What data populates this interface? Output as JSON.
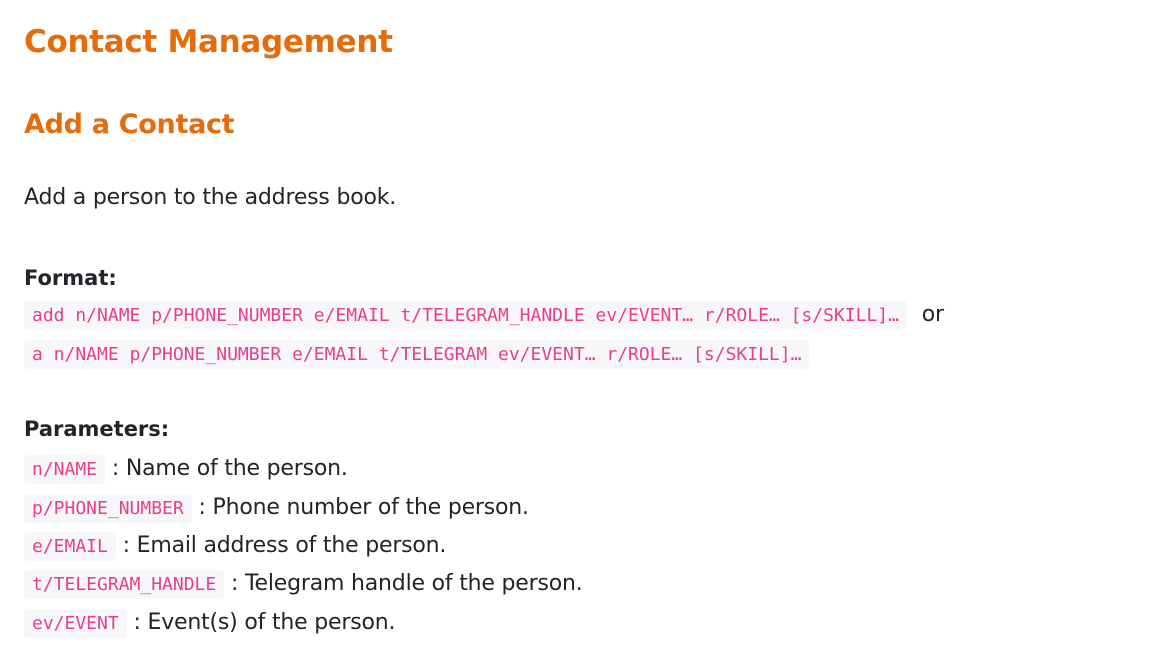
{
  "heading": "Contact Management",
  "section": {
    "title": "Add a Contact",
    "intro": "Add a person to the address book."
  },
  "format": {
    "label": "Format:",
    "command_full": "add n/NAME p/PHONE_NUMBER e/EMAIL t/TELEGRAM_HANDLE ev/EVENT… r/ROLE… [s/SKILL]…",
    "or_text": "or",
    "command_short": "a n/NAME p/PHONE_NUMBER e/EMAIL t/TELEGRAM ev/EVENT… r/ROLE… [s/SKILL]…"
  },
  "parameters": {
    "label": "Parameters:",
    "items": [
      {
        "code": "n/NAME",
        "desc": ": Name of the person."
      },
      {
        "code": "p/PHONE_NUMBER",
        "desc": ": Phone number of the person."
      },
      {
        "code": "e/EMAIL",
        "desc": ": Email address of the person."
      },
      {
        "code": "t/TELEGRAM_HANDLE",
        "desc": ": Telegram handle of the person."
      },
      {
        "code": "ev/EVENT",
        "desc": ": Event(s) of the person."
      }
    ]
  },
  "colors": {
    "heading": "#e46c0a",
    "code_text": "#e83e8c",
    "code_bg": "#f7f7f9",
    "body_text": "#212529"
  }
}
